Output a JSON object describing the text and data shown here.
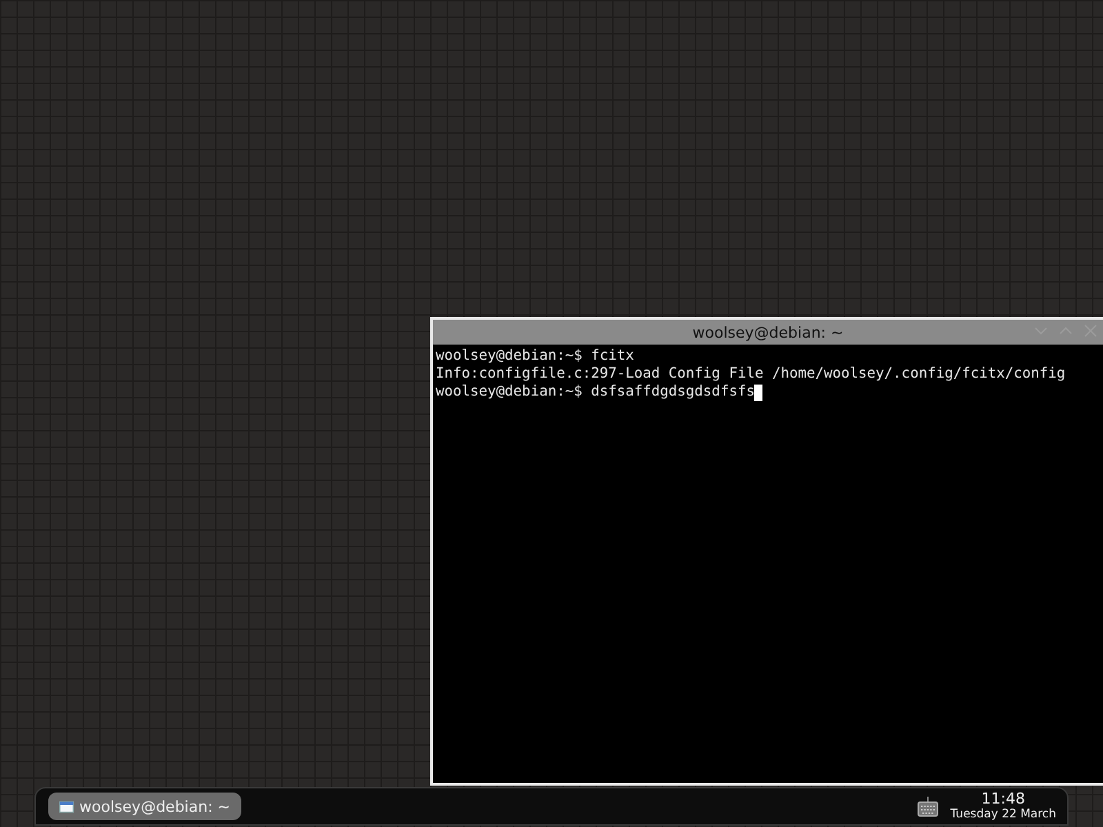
{
  "terminal_window": {
    "title": "woolsey@debian: ~",
    "lines": [
      {
        "text": "woolsey@debian:~$ fcitx",
        "cursor": false
      },
      {
        "text": "Info:configfile.c:297-Load Config File /home/woolsey/.config/fcitx/config",
        "cursor": false
      },
      {
        "text": "woolsey@debian:~$ dsfsaffdgdsgdsdfsfs",
        "cursor": true
      }
    ]
  },
  "taskbar": {
    "tasks": [
      {
        "label": "woolsey@debian: ~",
        "selected": true
      }
    ],
    "clock": {
      "time": "11:48",
      "date": "Tuesday 22 March"
    }
  }
}
